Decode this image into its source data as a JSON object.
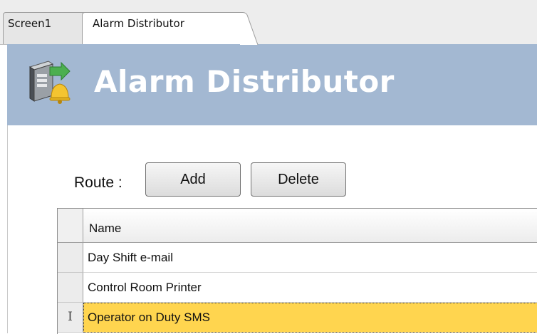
{
  "tabs": [
    {
      "label": "Screen1"
    },
    {
      "label": "Alarm Distributor"
    }
  ],
  "header": {
    "title": "Alarm Distributor",
    "icon": "alarm-server-icon",
    "background_color": "#a3b8d2"
  },
  "route": {
    "label": "Route :",
    "add_label": "Add",
    "delete_label": "Delete"
  },
  "grid": {
    "columns": [
      "Name"
    ],
    "rows": [
      {
        "name": "Day Shift e-mail",
        "indicator": ""
      },
      {
        "name": "Control Room Printer",
        "indicator": ""
      },
      {
        "name": "Operator on Duty SMS",
        "indicator": "I",
        "selected": true
      }
    ],
    "selected_color": "#ffd54f"
  }
}
